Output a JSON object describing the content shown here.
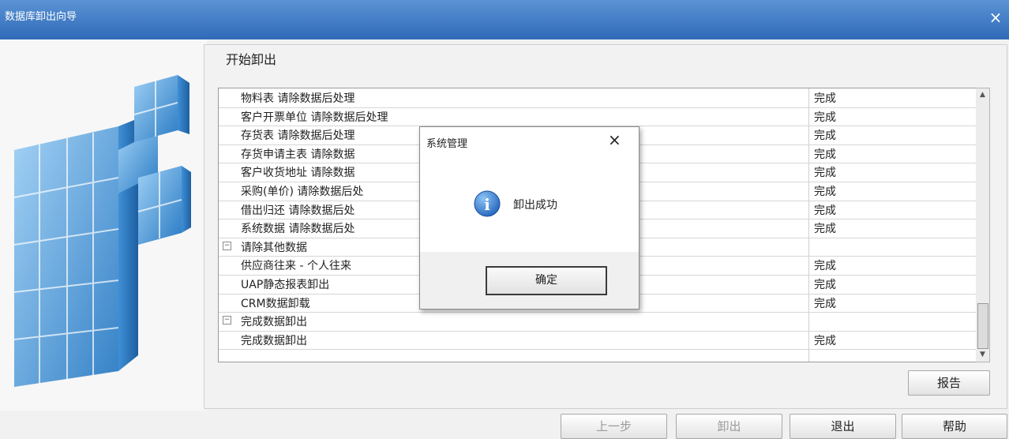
{
  "window": {
    "title": "数据库卸出向导",
    "close_glyph": "×"
  },
  "section_title": "开始卸出",
  "rows": [
    {
      "name": "物料表 请除数据后处理",
      "status": "完成"
    },
    {
      "name": "客户开票单位 请除数据后处理",
      "status": "完成"
    },
    {
      "name": "存货表 请除数据后处理",
      "status": "完成"
    },
    {
      "name": "存货申请主表 请除数据",
      "status": "完成"
    },
    {
      "name": "客户收货地址 请除数据",
      "status": "完成"
    },
    {
      "name": "采购(单价) 请除数据后处",
      "status": "完成"
    },
    {
      "name": "借出归还 请除数据后处",
      "status": "完成"
    },
    {
      "name": "系统数据 请除数据后处",
      "status": "完成"
    },
    {
      "name": "请除其他数据",
      "status": "",
      "group": true,
      "toggle": "−"
    },
    {
      "name": "供应商往来 - 个人往来",
      "status": "完成"
    },
    {
      "name": "UAP静态报表卸出",
      "status": "完成"
    },
    {
      "name": "CRM数据卸载",
      "status": "完成"
    },
    {
      "name": "完成数据卸出",
      "status": "",
      "group": true,
      "toggle": "−"
    },
    {
      "name": "完成数据卸出",
      "status": "完成"
    }
  ],
  "scroll": {
    "up": "▲",
    "down": "▼"
  },
  "buttons": {
    "report": "报告",
    "prev": "上一步",
    "unload": "卸出",
    "exit": "退出",
    "help": "帮助"
  },
  "dialog": {
    "title": "系统管理",
    "close_glyph": "×",
    "message": "卸出成功",
    "icon_glyph": "i",
    "ok": "确定"
  },
  "colors": {
    "titlebar": "#2f6ab8",
    "info_icon": "#1e66c0",
    "cube_blue": "#4a9de0"
  },
  "icons": [
    "close-icon",
    "info-icon",
    "server-cubes-illustration",
    "tree-collapse-icon",
    "scroll-up-icon",
    "scroll-down-icon"
  ]
}
